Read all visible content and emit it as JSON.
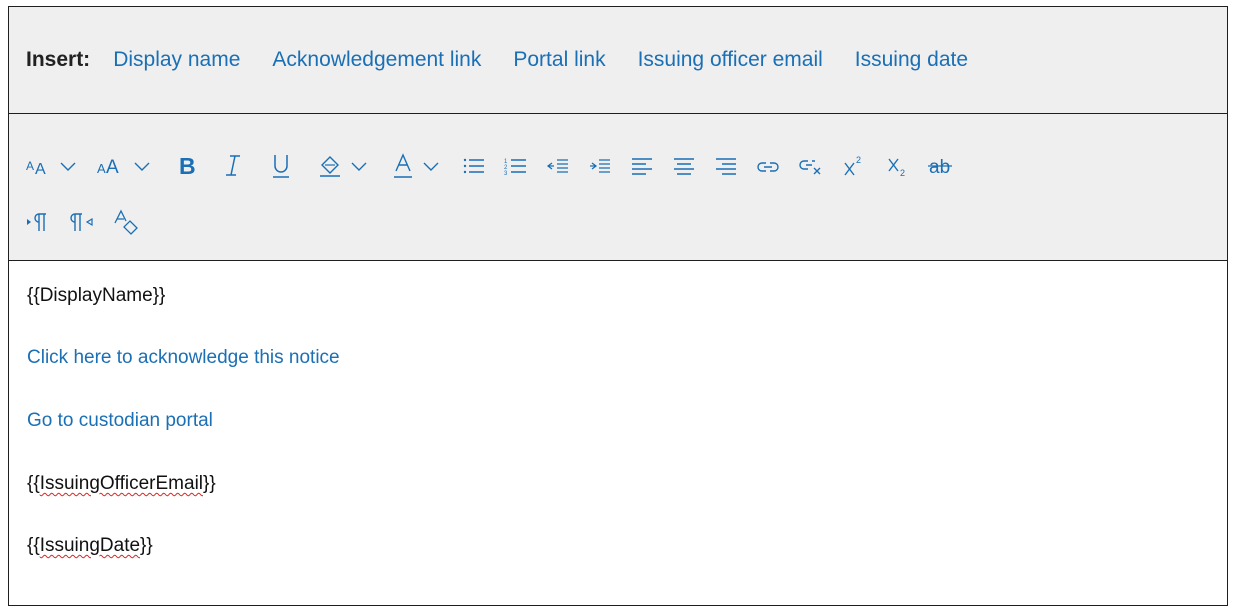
{
  "insert_bar": {
    "label": "Insert:",
    "links": [
      "Display name",
      "Acknowledgement link",
      "Portal link",
      "Issuing officer email",
      "Issuing date"
    ]
  },
  "toolbar": {
    "row1": [
      "font-size-icon",
      "chevron-down-icon",
      "grow-font-icon",
      "chevron-down-icon",
      "bold-icon",
      "italic-icon",
      "underline-icon",
      "highlight-icon",
      "chevron-down-icon",
      "font-color-icon",
      "chevron-down-icon",
      "bulleted-list-icon",
      "numbered-list-icon",
      "decrease-indent-icon",
      "increase-indent-icon",
      "align-left-icon",
      "align-center-icon",
      "align-right-icon",
      "insert-link-icon",
      "remove-link-icon",
      "superscript-icon",
      "subscript-icon",
      "strikethrough-icon"
    ],
    "row2": [
      "ltr-icon",
      "rtl-icon",
      "clear-formatting-icon"
    ],
    "accent_color": "#1a6fb5"
  },
  "editor": {
    "lines": [
      {
        "prefix": "{{",
        "word": "DisplayName",
        "suffix": "}}",
        "style": "plain",
        "spell_error": false
      },
      {
        "prefix": "",
        "word": "Click here to acknowledge this notice",
        "suffix": "",
        "style": "link",
        "spell_error": false
      },
      {
        "prefix": "",
        "word": "Go to custodian portal",
        "suffix": "",
        "style": "link",
        "spell_error": false
      },
      {
        "prefix": "{{",
        "word": "IssuingOfficerEmail",
        "suffix": "}}",
        "style": "plain",
        "spell_error": true
      },
      {
        "prefix": "{{",
        "word": "IssuingDate",
        "suffix": "}}",
        "style": "plain",
        "spell_error": true
      }
    ]
  }
}
